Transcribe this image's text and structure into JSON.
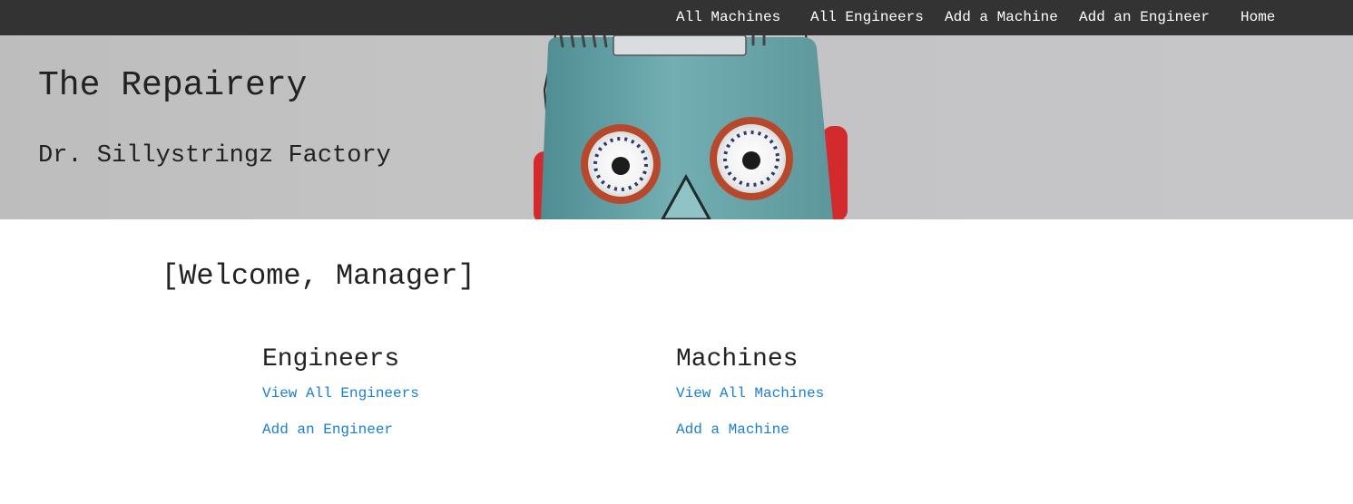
{
  "nav": {
    "items": [
      {
        "label": "All Machines"
      },
      {
        "label": "All Engineers"
      },
      {
        "label": "Add a Machine"
      },
      {
        "label": "Add an Engineer"
      },
      {
        "label": "Home"
      }
    ]
  },
  "hero": {
    "title": "The Repairery",
    "subtitle": "Dr. Sillystringz Factory",
    "image_icon": "toy-robot"
  },
  "main": {
    "welcome": "[Welcome, Manager]",
    "engineers": {
      "heading": "Engineers",
      "links": [
        {
          "label": "View All Engineers"
        },
        {
          "label": "Add an Engineer"
        }
      ]
    },
    "machines": {
      "heading": "Machines",
      "links": [
        {
          "label": "View All Machines"
        },
        {
          "label": "Add a Machine"
        }
      ]
    }
  },
  "colors": {
    "nav_background": "#333333",
    "nav_text": "#ffffff",
    "link": "#1a7fd4",
    "heading_text": "#222222",
    "robot_body": "#6aa4a8",
    "robot_ears": "#d9262b"
  }
}
